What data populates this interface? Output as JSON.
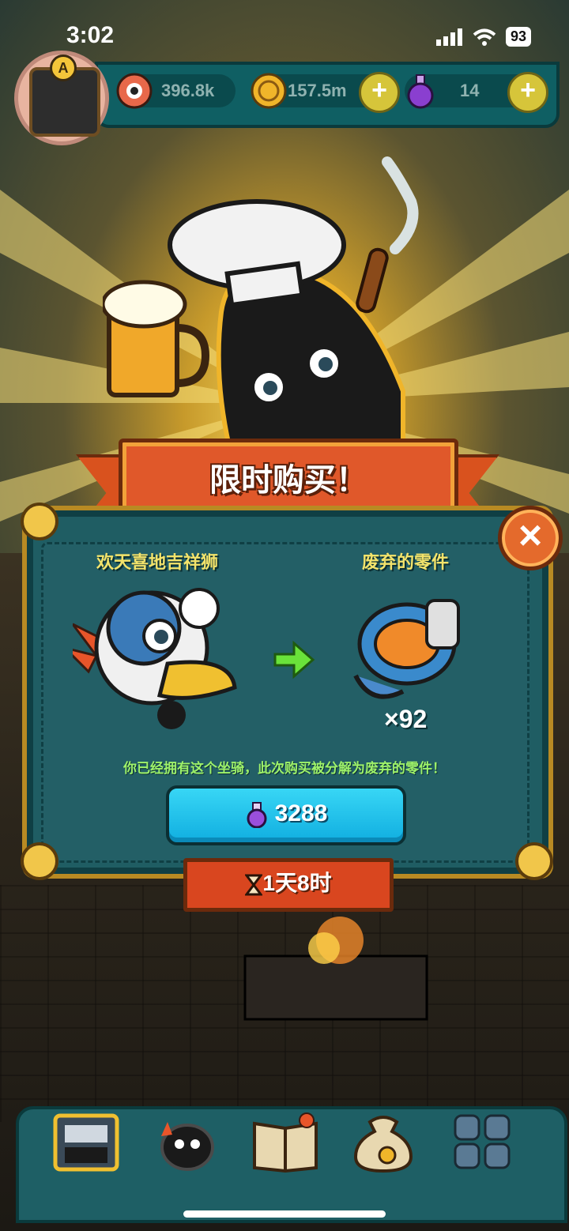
{
  "status_bar": {
    "time": "3:02",
    "battery": "93"
  },
  "resources": [
    {
      "name": "eyeball",
      "value": "396.8k"
    },
    {
      "name": "coin",
      "value": "157.5m"
    },
    {
      "name": "potion",
      "value": "14"
    }
  ],
  "avatar_badge": "A",
  "banner": {
    "title": "限时购买！"
  },
  "offer": {
    "left_item_name": "欢天喜地吉祥狮",
    "right_item_name": "废弃的零件",
    "quantity": "×92",
    "notice": "你已经拥有这个坐骑，此次购买被分解为废弃的零件！",
    "price": "3288",
    "time_left": "1天8时"
  },
  "icons": {
    "close": "close-icon",
    "arrow": "arrow-right-icon",
    "potion": "potion-icon",
    "hourglass": "hourglass-icon"
  },
  "colors": {
    "panel": "#1f5d63",
    "banner": "#e0582a",
    "button": "#1bbdec",
    "notice": "#9ef26a",
    "title": "#f3e36b"
  },
  "nav": [
    {
      "name": "shop"
    },
    {
      "name": "monster"
    },
    {
      "name": "book"
    },
    {
      "name": "bag"
    },
    {
      "name": "menu"
    }
  ]
}
